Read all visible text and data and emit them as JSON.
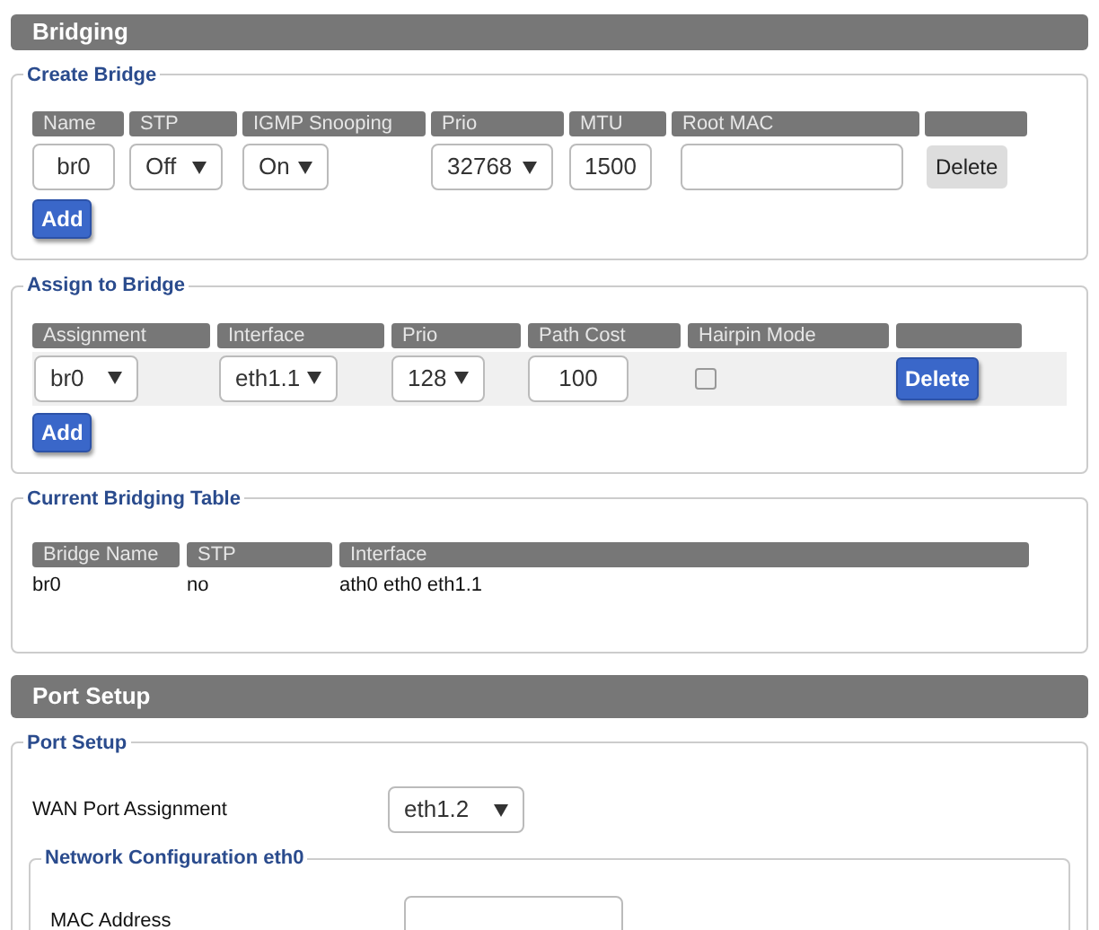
{
  "bridging": {
    "title": "Bridging",
    "create_bridge": {
      "legend": "Create Bridge",
      "columns": [
        "Name",
        "STP",
        "IGMP Snooping",
        "Prio",
        "MTU",
        "Root MAC"
      ],
      "rows": [
        {
          "name": "br0",
          "stp": "Off",
          "igmp_snooping": "On",
          "prio": "32768",
          "mtu": "1500",
          "delete_button": "Delete",
          "disabled": true
        }
      ],
      "add_button": "Add"
    },
    "assign_to_bridge": {
      "legend": "Assign to Bridge",
      "columns": [
        "Assignment",
        "Interface",
        "Prio",
        "Path Cost",
        "Hairpin Mode"
      ],
      "rows": [
        {
          "assignment": "br0",
          "interface": "eth1.1",
          "prio": "128",
          "path_cost": "100",
          "hairpin_mode": false,
          "delete_button": "Delete",
          "disabled": false
        }
      ],
      "add_button": "Add"
    },
    "current_bridging_table": {
      "legend": "Current Bridging Table",
      "columns": [
        "Bridge Name",
        "STP",
        "Interface"
      ],
      "rows": [
        [
          "br0",
          "no",
          "ath0 eth0 eth1.1"
        ]
      ]
    }
  },
  "port_setup": {
    "title": "Port Setup",
    "legend": "Port Setup",
    "wan_port_assignment": {
      "label": "WAN Port Assignment",
      "value": "eth1.2"
    },
    "network_configuration": {
      "legend": "Network Configuration eth0",
      "mac_address": {
        "label": "MAC Address"
      }
    }
  }
}
